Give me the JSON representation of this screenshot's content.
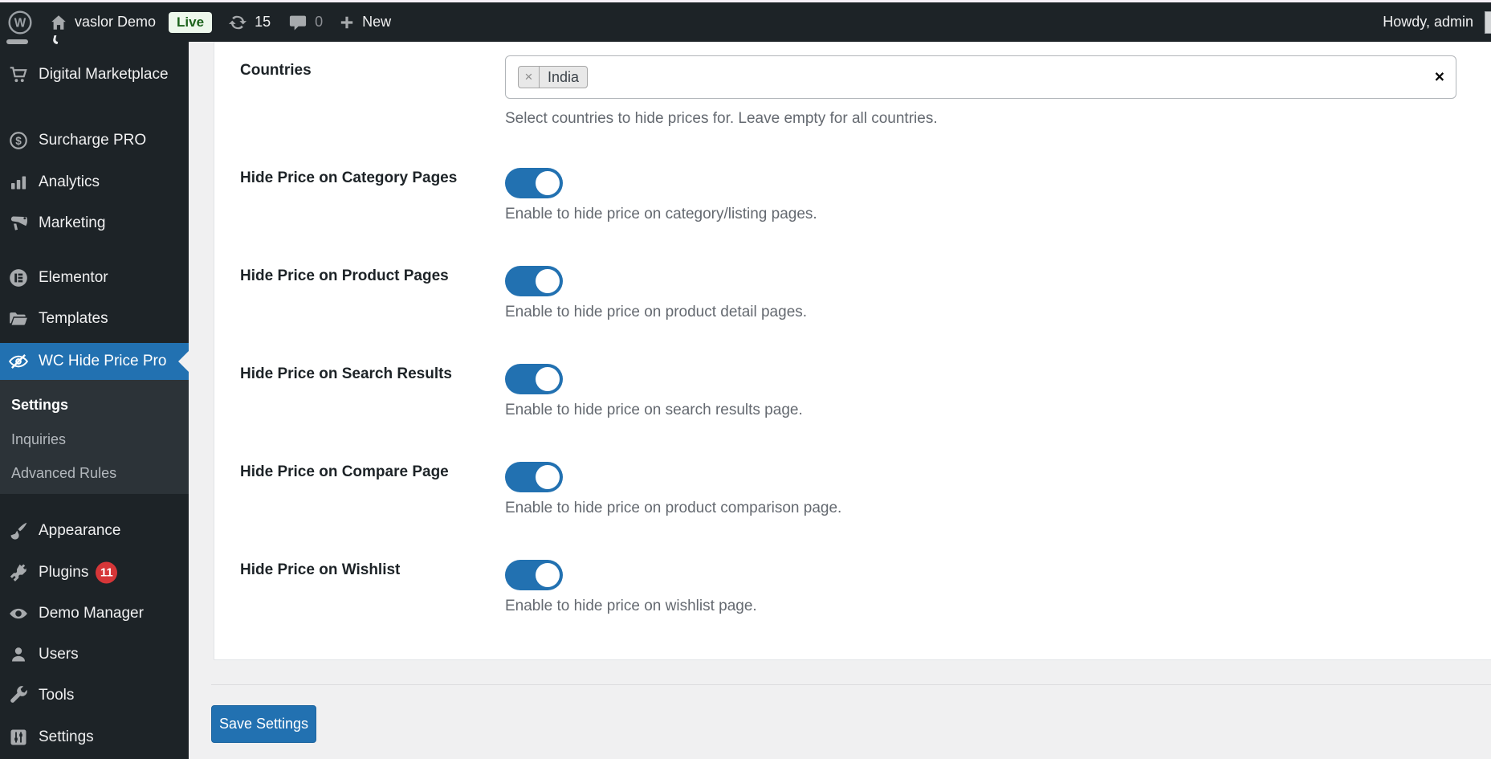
{
  "admin_bar": {
    "site_name": "vaslor Demo",
    "live_badge": "Live",
    "update_count": "15",
    "comment_count": "0",
    "new_label": "New",
    "howdy": "Howdy, admin"
  },
  "sidebar": {
    "items": [
      {
        "label": "Digital Marketplace",
        "icon": "cart-icon"
      },
      {
        "label": "Surcharge PRO",
        "icon": "dollar-circle-icon"
      },
      {
        "label": "Analytics",
        "icon": "bar-chart-icon"
      },
      {
        "label": "Marketing",
        "icon": "megaphone-icon"
      },
      {
        "label": "Elementor",
        "icon": "elementor-icon"
      },
      {
        "label": "Templates",
        "icon": "folder-icon"
      },
      {
        "label": "WC Hide Price Pro",
        "icon": "eye-slash-icon",
        "active": true
      },
      {
        "label": "Appearance",
        "icon": "brush-icon"
      },
      {
        "label": "Plugins",
        "icon": "plug-icon",
        "badge": "11"
      },
      {
        "label": "Demo Manager",
        "icon": "eye-icon"
      },
      {
        "label": "Users",
        "icon": "user-icon"
      },
      {
        "label": "Tools",
        "icon": "wrench-icon"
      },
      {
        "label": "Settings",
        "icon": "sliders-icon"
      }
    ],
    "submenu": [
      {
        "label": "Settings",
        "current": true
      },
      {
        "label": "Inquiries"
      },
      {
        "label": "Advanced Rules"
      }
    ]
  },
  "content": {
    "countries": {
      "label": "Countries",
      "tags": [
        "India"
      ],
      "description": "Select countries to hide prices for. Leave empty for all countries."
    },
    "toggles": [
      {
        "label": "Hide Price on Category Pages",
        "description": "Enable to hide price on category/listing pages.",
        "on": true
      },
      {
        "label": "Hide Price on Product Pages",
        "description": "Enable to hide price on product detail pages.",
        "on": true
      },
      {
        "label": "Hide Price on Search Results",
        "description": "Enable to hide price on search results page.",
        "on": true
      },
      {
        "label": "Hide Price on Compare Page",
        "description": "Enable to hide price on product comparison page.",
        "on": true
      },
      {
        "label": "Hide Price on Wishlist",
        "description": "Enable to hide price on wishlist page.",
        "on": true
      }
    ],
    "save_label": "Save Settings"
  },
  "icons": {
    "remove_glyph": "×",
    "clear_glyph": "×"
  },
  "colors": {
    "accent_blue": "#2271b1",
    "admin_dark": "#1d2327",
    "submenu_dark": "#2c3338",
    "page_bg": "#f0f0f1",
    "badge_red": "#d63638",
    "live_green_bg": "#edf7ec",
    "live_green_text": "#1c621c",
    "muted_text": "#646970"
  }
}
